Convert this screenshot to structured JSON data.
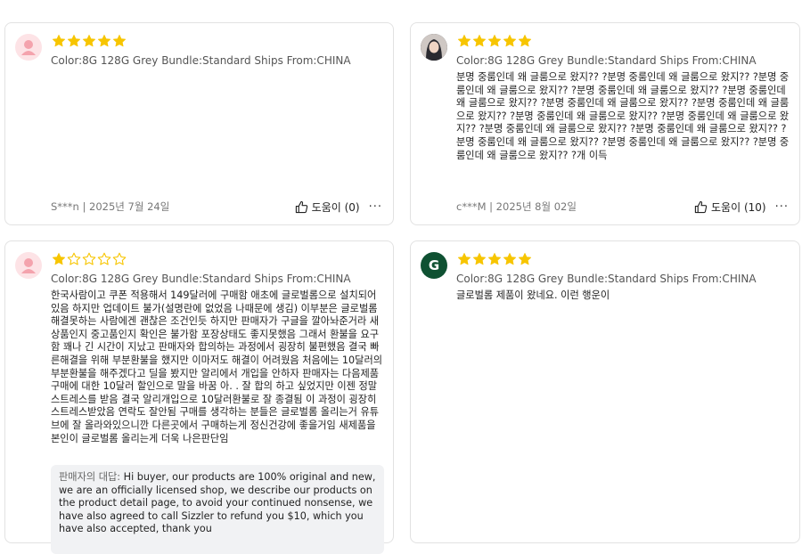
{
  "reviews": [
    {
      "avatar": "default-user-icon",
      "rating": 5,
      "sku": "Color:8G 128G Grey Bundle:Standard Ships From:CHINA",
      "text": "",
      "author": "S***n | 2025년 7월 24일",
      "helpful": "도움이 (0)"
    },
    {
      "avatar": "photo",
      "rating": 5,
      "sku": "Color:8G 128G Grey Bundle:Standard Ships From:CHINA",
      "text": "분명 중룸인데 왜 글룸으로 왔지?? ?분명 중룸인데 왜 글룸으로 왔지?? ?분명 중룸인데 왜 글룸으로 왔지?? ?분명 중룸인데 왜 글룸으로 왔지?? ?분명 중룸인데 왜 글룸으로 왔지?? ?분명 중룸인데 왜 글룸으로 왔지?? ?분명 중룸인데 왜 글룸으로 왔지?? ?분명 중룸인데 왜 글룸으로 왔지?? ?분명 중룸인데 왜 글룸으로 왔지?? ?분명 중룸인데 왜 글룸으로 왔지?? ?분명 중룸인데 왜 글룸으로 왔지?? ?분명 중룸인데 왜 글룸으로 왔지?? ?분명 중룸인데 왜 글룸으로 왔지?? ?분명 중룸인데 왜 글룸으로 왔지?? ?개 이득",
      "author": "c***M | 2025년 8월 02일",
      "helpful": "도움이 (10)"
    },
    {
      "avatar": "default-user-icon",
      "rating": 1,
      "sku": "Color:8G 128G Grey Bundle:Standard Ships From:CHINA",
      "text": "한국사람이고 쿠폰 적용해서 149달러에 구매함 애초에 글로벌롬으로 설치되어있음 하지만 업데이트 불가(설명란에 없었음 나때문에 생김) 이부분은 글로벌롬 해결못하는 사람에겐 괜찮은 조건인듯 하지만 판매자가 구글을 깔아놔준거라 새상품인지 중고품인지 확인은 불가함 포장상태도 좋지못했음 그래서 환불을 요구함 꽤나 긴 시간이 지났고 판매자와 합의하는 과정에서 굉장히 불편했음 결국 빠른해결을 위해 부분환불을 했지만 이마저도 해결이 어려웠음 처음에는 10달러의 부분환불을 해주겠다고 딜을 봤지만 알리에서 개입을 안하자 판매자는 다음제품 구매에 대한 10달러 할인으로 말을 바꿈 아. . 잘 합의 하고 싶었지만 이젠 정말 스트레스를 받음 결국 알리개입으로 10달러환불로 잘 종결됨 이 과정이 굉장히 스트레스받았음 연락도 잘안됨 구매를 생각하는 분들은 글로벌롬 올리는거 유튜브에 잘 올라와있으니깐 다른곳에서 구매하는게 정신건강에 좋을거임 새제품을 본인이 글로벌롬 올리는게 더욱 나은판단임",
      "reply_label": "판매자의 대답:",
      "reply_text": "Hi buyer, our products are 100% original and new, we are an officially licensed shop, we describe our products on the product detail page, to avoid your continued nonsense, we have also agreed to call Sizzler to refund you $10, which you have also accepted, thank you"
    },
    {
      "avatar": "G",
      "rating": 5,
      "sku": "Color:8G 128G Grey Bundle:Standard Ships From:CHINA",
      "text": "글로벌롬 제품이 왔네요. 이런 행운이"
    }
  ],
  "colors": {
    "star": "#f7c500",
    "star_empty_stroke": "#f7c500",
    "reply_bg": "#f1f2f4"
  },
  "icons": {
    "helpful": "thumbs-up-icon",
    "more": "more-dots-icon"
  }
}
